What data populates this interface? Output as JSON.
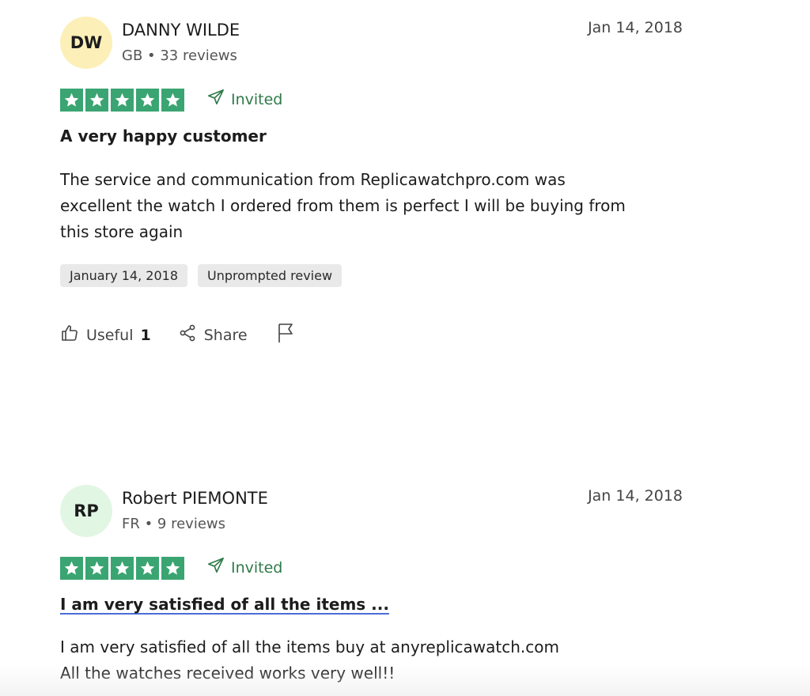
{
  "reviews": [
    {
      "initials": "DW",
      "avatar_color": "#fcefb8",
      "name": "DANNY WILDE",
      "meta": "GB • 33 reviews",
      "date": "Jan 14, 2018",
      "rating": 5,
      "invited_label": "Invited",
      "title": "A very happy customer",
      "body_lines": [
        "The service and communication from Replicawatchpro.com was",
        "excellent the watch I ordered from them is perfect I will be buying from",
        "this store again"
      ],
      "tags": [
        "January 14, 2018",
        "Unprompted review"
      ],
      "useful_label": "Useful",
      "useful_count": "1",
      "share_label": "Share"
    },
    {
      "initials": "RP",
      "avatar_color": "#e2f6e4",
      "name": "Robert PIEMONTE",
      "meta": "FR • 9 reviews",
      "date": "Jan 14, 2018",
      "rating": 5,
      "invited_label": "Invited",
      "title": "I am very satisfied of all the items ...",
      "body_lines": [
        "I am very satisfied of all the items buy at anyreplicawatch.com",
        "All the watches received works very well!!"
      ]
    }
  ],
  "colors": {
    "star_green": "#3aa572",
    "invited_green": "#2f7a49",
    "link_underline": "#4b6ed6"
  },
  "icons": [
    "star-icon",
    "paper-plane-icon",
    "thumbs-up-icon",
    "share-icon",
    "flag-icon"
  ]
}
